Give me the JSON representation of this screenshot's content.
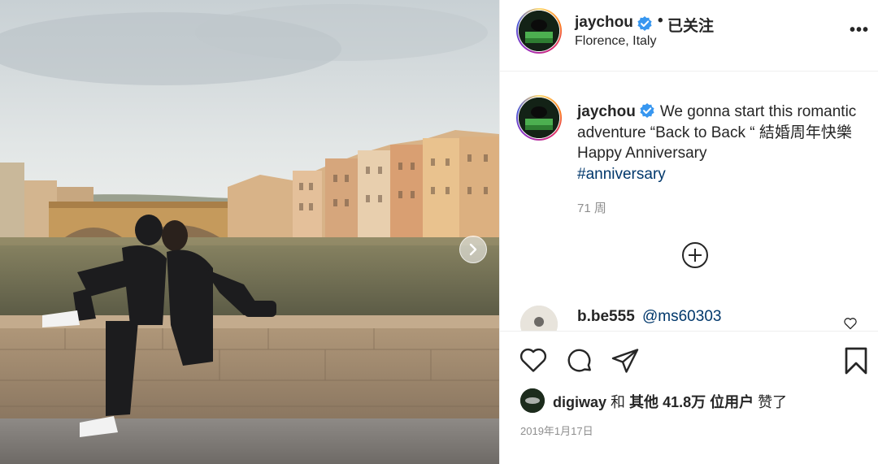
{
  "post": {
    "image": {
      "description_icon": "carousel-next-icon"
    },
    "header": {
      "username": "jaychou",
      "separator": "•",
      "follow_label": "已关注",
      "location": "Florence, Italy",
      "more_label": "•••"
    },
    "caption": {
      "username": "jaychou",
      "text": "We gonna start this romantic adventure “Back to Back “ 結婚周年快樂 Happy Anniversary",
      "hashtag": "#anniversary",
      "time": "71 周"
    },
    "comment": {
      "username": "b.be555",
      "mention": "@ms60303"
    },
    "likes": {
      "user": "digiway",
      "connector": "和",
      "others_prefix": "其他",
      "count": "41.8万",
      "others_suffix": "位用户",
      "verb": "赞了"
    },
    "date": "2019年1月17日",
    "colors": {
      "verified": "#3897f0",
      "link": "#00376b",
      "secondary_text": "#8e8e8e",
      "border": "#efefef"
    }
  }
}
